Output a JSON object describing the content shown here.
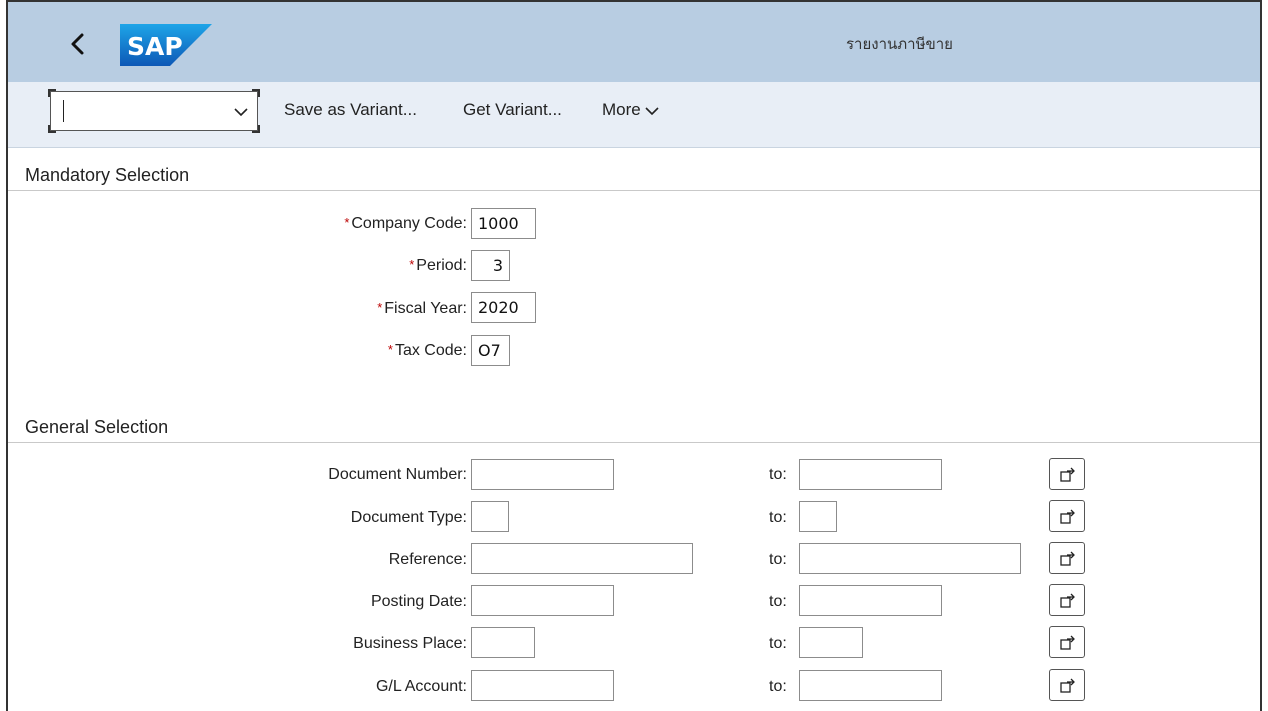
{
  "shell": {
    "title": "รายงานภาษีขาย",
    "logo_text": "SAP",
    "brand_color": "#1a73c9"
  },
  "toolbar": {
    "variant_value": "",
    "save_variant": "Save as Variant...",
    "get_variant": "Get Variant...",
    "more": "More"
  },
  "mandatory": {
    "title": "Mandatory Selection",
    "fields": [
      {
        "label": "Company Code:",
        "value": "1000"
      },
      {
        "label": "Period:",
        "value": "3"
      },
      {
        "label": "Fiscal Year:",
        "value": "2020"
      },
      {
        "label": "Tax Code:",
        "value": "O7"
      }
    ]
  },
  "general": {
    "title": "General Selection",
    "to_label": "to:",
    "rows": [
      {
        "label": "Document Number:",
        "from": "",
        "to": ""
      },
      {
        "label": "Document Type:",
        "from": "",
        "to": ""
      },
      {
        "label": "Reference:",
        "from": "",
        "to": ""
      },
      {
        "label": "Posting Date:",
        "from": "",
        "to": ""
      },
      {
        "label": "Business Place:",
        "from": "",
        "to": ""
      },
      {
        "label": "G/L Account:",
        "from": "",
        "to": ""
      }
    ]
  }
}
